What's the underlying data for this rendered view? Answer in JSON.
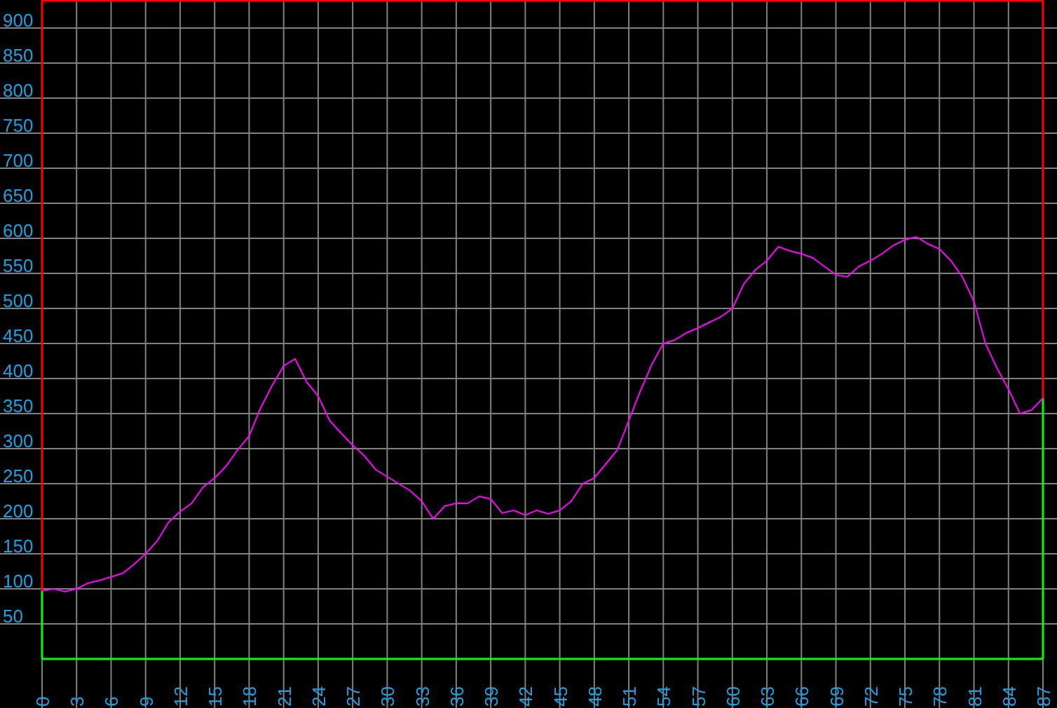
{
  "chart_data": {
    "type": "line",
    "grid": true,
    "xlim": [
      0,
      87
    ],
    "ylim": [
      0,
      940
    ],
    "xticks": [
      0,
      3,
      6,
      9,
      12,
      15,
      18,
      21,
      24,
      27,
      30,
      33,
      36,
      39,
      42,
      45,
      48,
      51,
      54,
      57,
      60,
      63,
      66,
      69,
      72,
      75,
      78,
      81,
      84,
      87
    ],
    "yticks": [
      50,
      100,
      150,
      200,
      250,
      300,
      350,
      400,
      450,
      500,
      550,
      600,
      650,
      700,
      750,
      800,
      850,
      900
    ],
    "x": [
      0,
      1,
      2,
      3,
      4,
      5,
      6,
      7,
      8,
      9,
      10,
      11,
      12,
      13,
      14,
      15,
      16,
      17,
      18,
      19,
      20,
      21,
      22,
      23,
      24,
      25,
      26,
      27,
      28,
      29,
      30,
      31,
      32,
      33,
      34,
      35,
      36,
      37,
      38,
      39,
      40,
      41,
      42,
      43,
      44,
      45,
      46,
      47,
      48,
      49,
      50,
      51,
      52,
      53,
      54,
      55,
      56,
      57,
      58,
      59,
      60,
      61,
      62,
      63,
      64,
      65,
      66,
      67,
      68,
      69,
      70,
      71,
      72,
      73,
      74,
      75,
      76,
      77,
      78,
      79,
      80,
      81,
      82,
      83,
      84,
      85,
      86,
      87
    ],
    "series": [
      {
        "color": "#ff00ff",
        "values": [
          97,
          100,
          96,
          100,
          108,
          112,
          117,
          122,
          135,
          150,
          168,
          195,
          210,
          222,
          245,
          258,
          275,
          298,
          318,
          358,
          390,
          418,
          428,
          395,
          375,
          340,
          322,
          305,
          290,
          270,
          260,
          250,
          240,
          225,
          200,
          218,
          222,
          222,
          232,
          228,
          208,
          212,
          205,
          212,
          207,
          212,
          225,
          250,
          258,
          278,
          298,
          340,
          382,
          420,
          450,
          455,
          465,
          472,
          480,
          488,
          500,
          535,
          555,
          568,
          588,
          582,
          578,
          572,
          560,
          548,
          545,
          560,
          568,
          578,
          590,
          598,
          602,
          592,
          585,
          568,
          545,
          510,
          450,
          415,
          385,
          350,
          355,
          372
        ]
      }
    ]
  }
}
